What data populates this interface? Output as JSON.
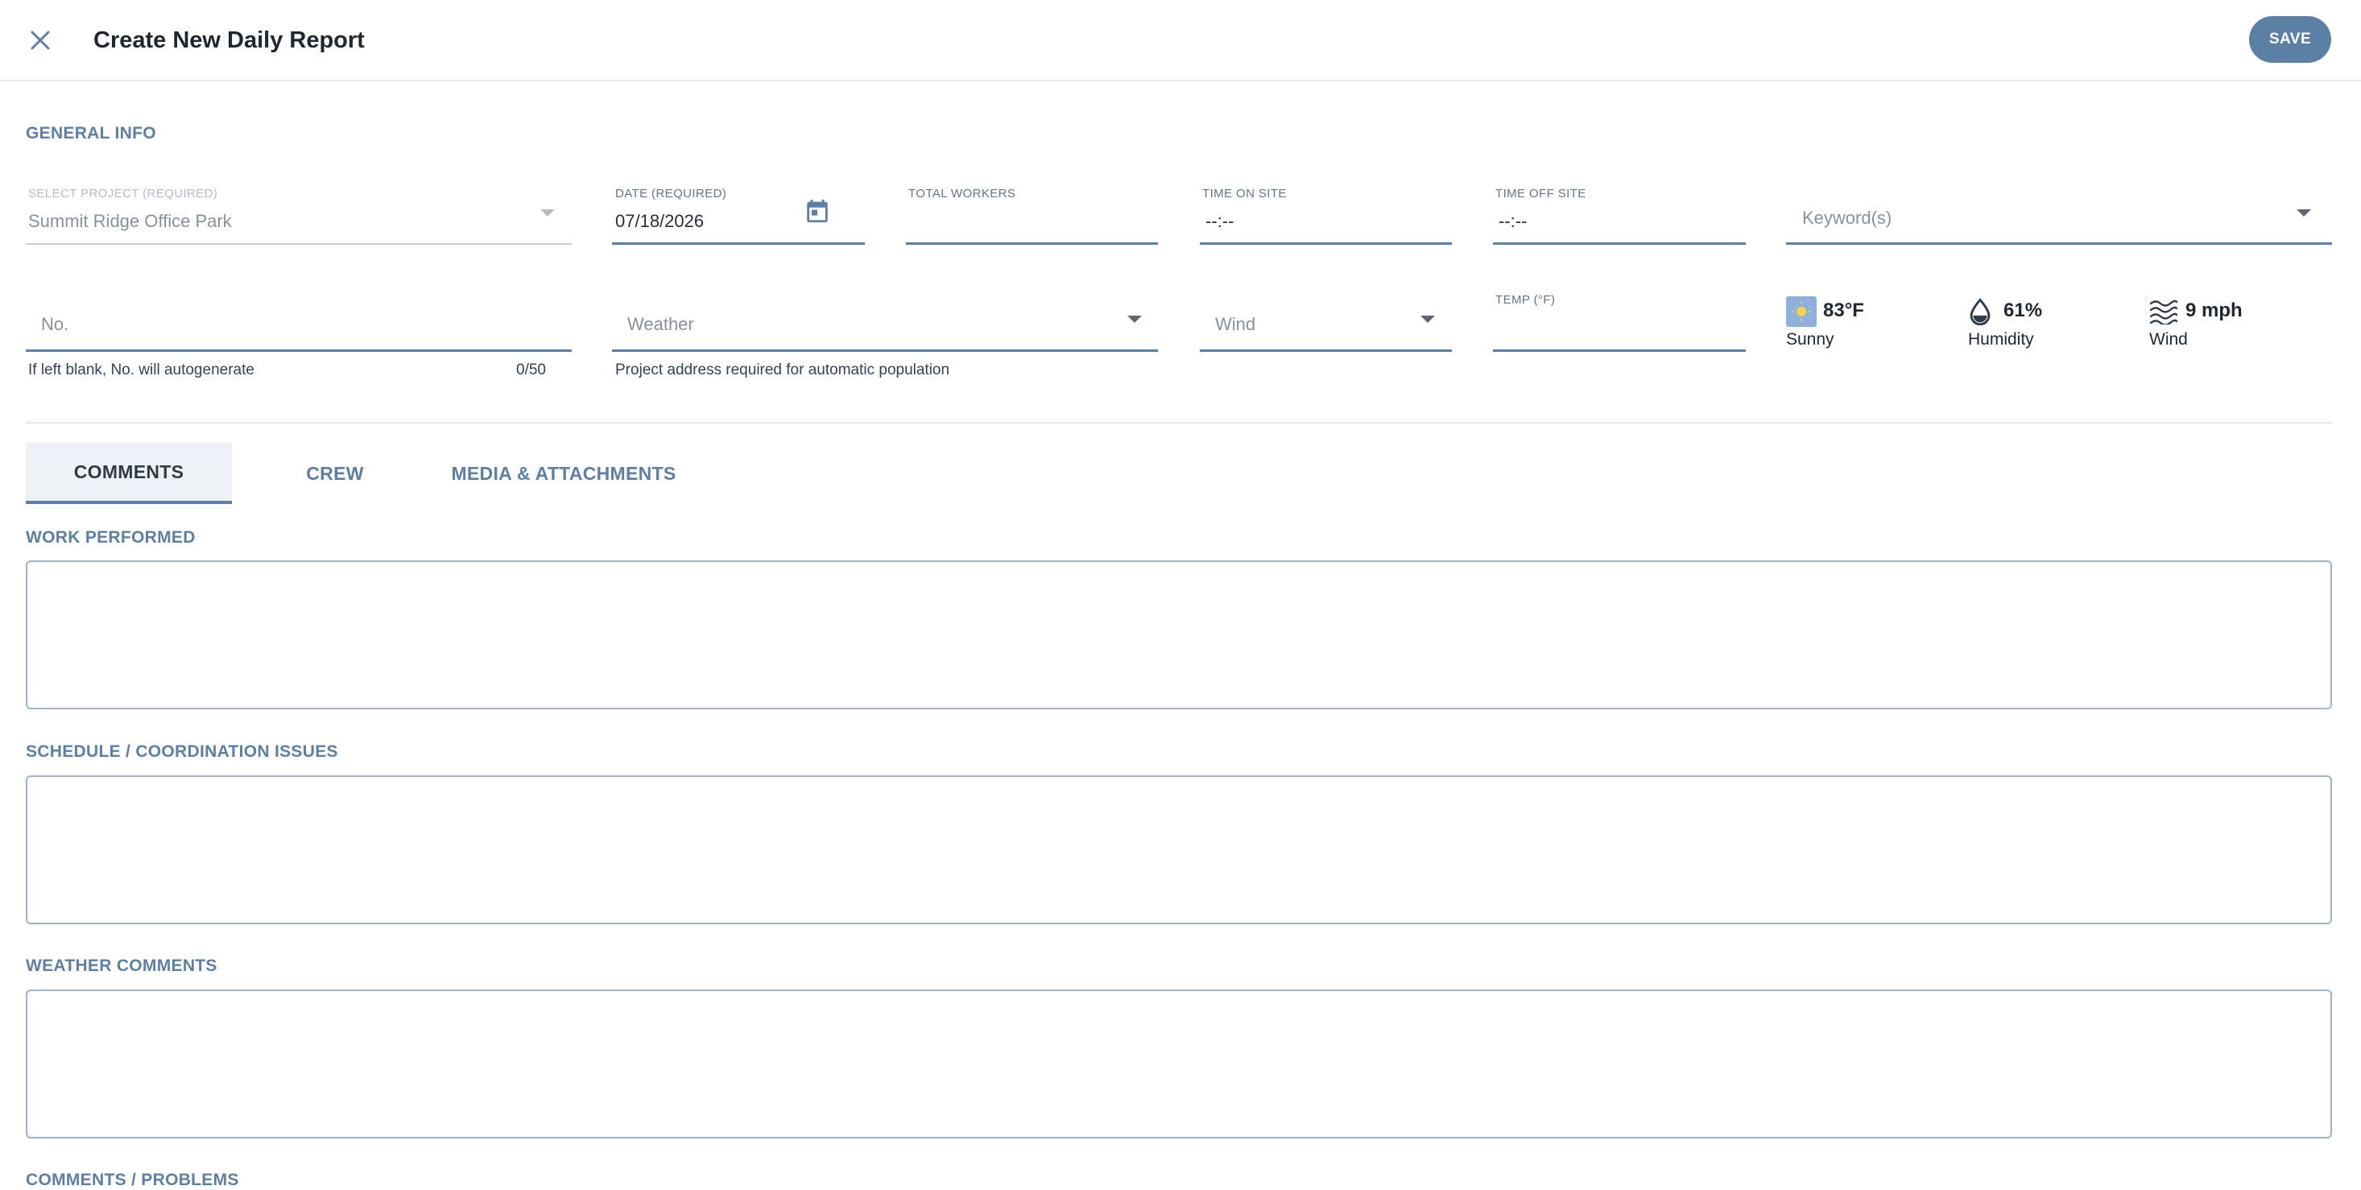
{
  "header": {
    "title": "Create New Daily Report",
    "save_label": "SAVE"
  },
  "general_info": {
    "section_title": "GENERAL INFO",
    "project": {
      "label": "SELECT PROJECT (REQUIRED)",
      "value": "Summit Ridge Office Park"
    },
    "date": {
      "label": "DATE (REQUIRED)",
      "value": "07/18/2026"
    },
    "total_workers": {
      "label": "TOTAL WORKERS",
      "value": ""
    },
    "time_on_site": {
      "label": "TIME ON SITE",
      "value": "--:--"
    },
    "time_off_site": {
      "label": "TIME OFF SITE",
      "value": "--:--"
    },
    "keywords": {
      "placeholder": "Keyword(s)"
    },
    "number": {
      "placeholder": "No.",
      "helper": "If left blank, No. will autogenerate",
      "counter": "0/50"
    },
    "weather_select": {
      "placeholder": "Weather",
      "helper": "Project address required for automatic population"
    },
    "wind_select": {
      "placeholder": "Wind"
    },
    "temp": {
      "label": "TEMP (°F)",
      "value": ""
    }
  },
  "conditions": {
    "temperature": {
      "value": "83°F",
      "caption": "Sunny",
      "icon": "sun-icon"
    },
    "humidity": {
      "value": "61%",
      "caption": "Humidity",
      "icon": "droplet-icon"
    },
    "wind": {
      "value": "9 mph",
      "caption": "Wind",
      "icon": "wind-waves-icon"
    }
  },
  "tabs": [
    {
      "label": "COMMENTS",
      "active": true
    },
    {
      "label": "CREW",
      "active": false
    },
    {
      "label": "MEDIA & ATTACHMENTS",
      "active": false
    }
  ],
  "comments": {
    "work_performed": {
      "label": "WORK PERFORMED",
      "value": ""
    },
    "schedule_issues": {
      "label": "SCHEDULE / COORDINATION ISSUES",
      "value": ""
    },
    "weather_comments": {
      "label": "WEATHER COMMENTS",
      "value": ""
    },
    "comments_problems": {
      "label": "COMMENTS / PROBLEMS"
    }
  },
  "colors": {
    "accent": "#5c7fa6",
    "active_tab_bg": "#eef2f6",
    "border": "#9fb3c8"
  }
}
